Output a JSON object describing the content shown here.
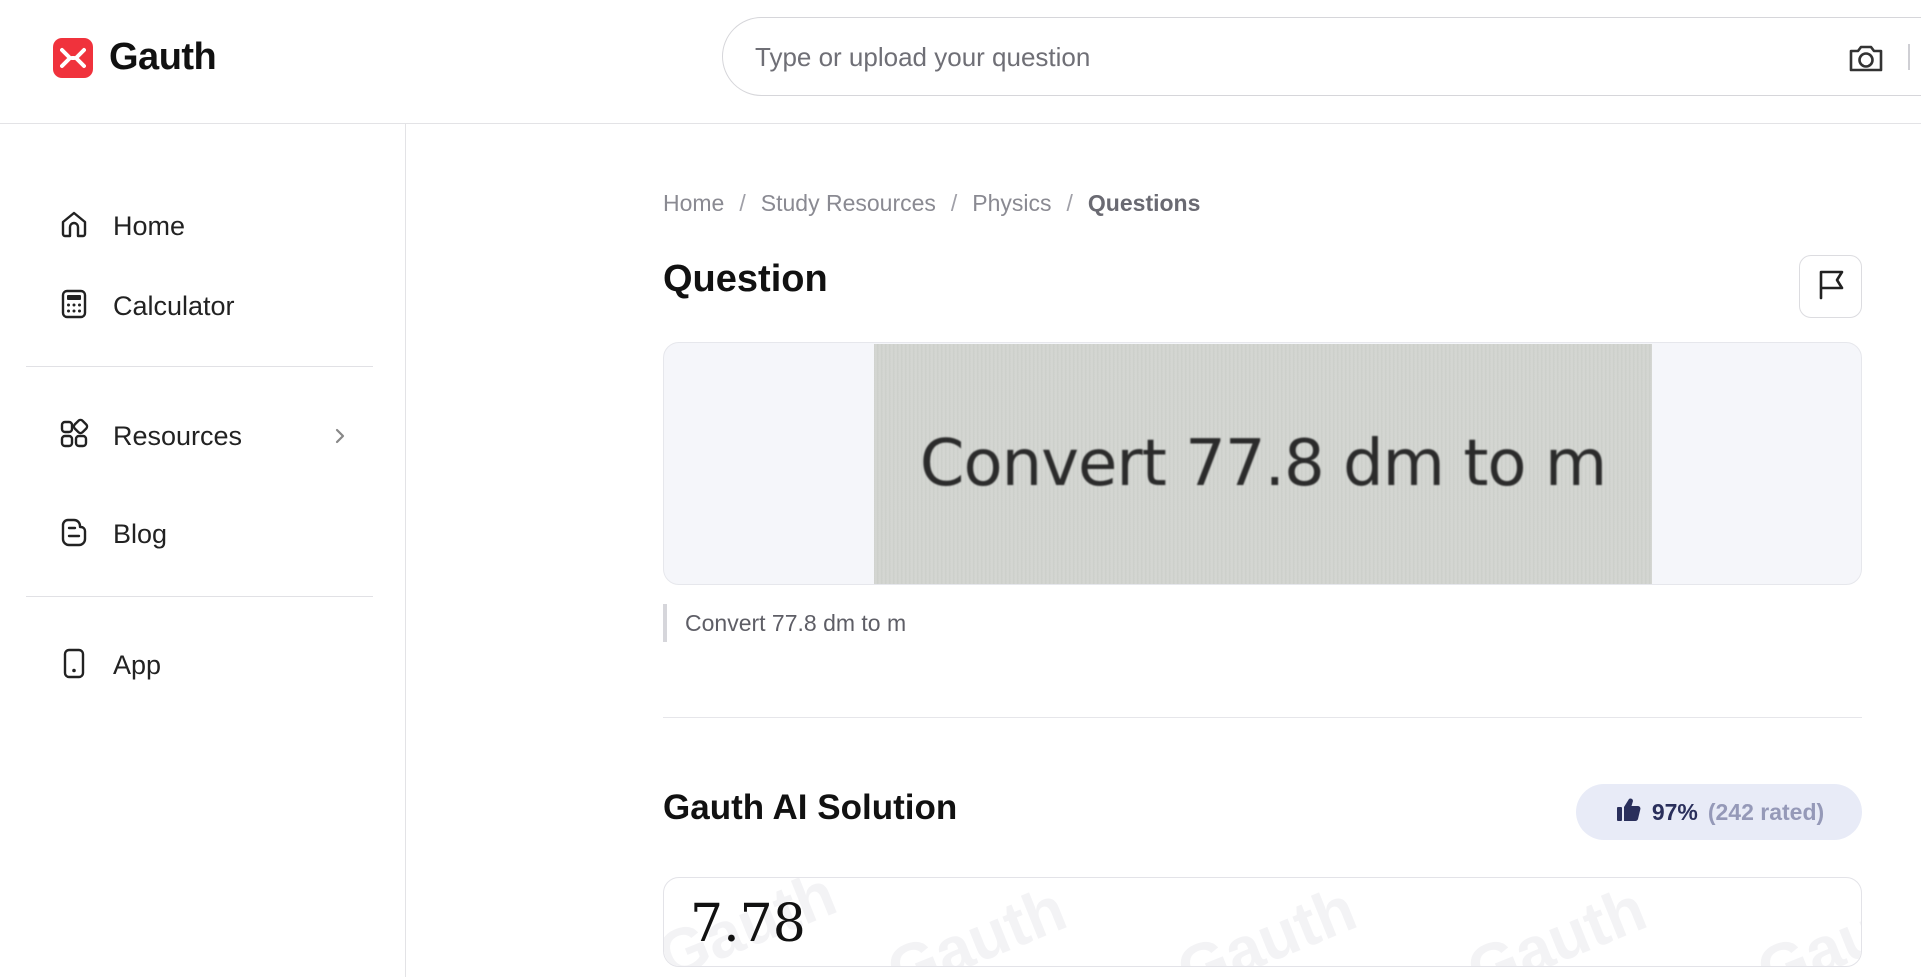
{
  "brand": {
    "name": "Gauth",
    "color": "#f0323c"
  },
  "search": {
    "placeholder": "Type or upload your question",
    "icon": "camera-icon"
  },
  "sidebar": {
    "items": [
      {
        "label": "Home",
        "icon": "home-icon"
      },
      {
        "label": "Calculator",
        "icon": "calculator-icon"
      },
      {
        "label": "Resources",
        "icon": "grid-icon",
        "has_submenu": true
      },
      {
        "label": "Blog",
        "icon": "blog-icon"
      },
      {
        "label": "App",
        "icon": "phone-icon"
      }
    ]
  },
  "breadcrumb": {
    "items": [
      "Home",
      "Study Resources",
      "Physics",
      "Questions"
    ],
    "separator": "/"
  },
  "question": {
    "heading": "Question",
    "image_text": "Convert 77.8 dm to m",
    "text": "Convert 77.8 dm to m"
  },
  "solution": {
    "heading": "Gauth AI Solution",
    "rating_percent": "97%",
    "rating_count": "(242 rated)",
    "answer": "7.78",
    "watermark": "Gauth"
  },
  "colors": {
    "accent": "#f0323c",
    "rating_bg": "#e8ebf7",
    "rating_text": "#2a2f5c"
  }
}
